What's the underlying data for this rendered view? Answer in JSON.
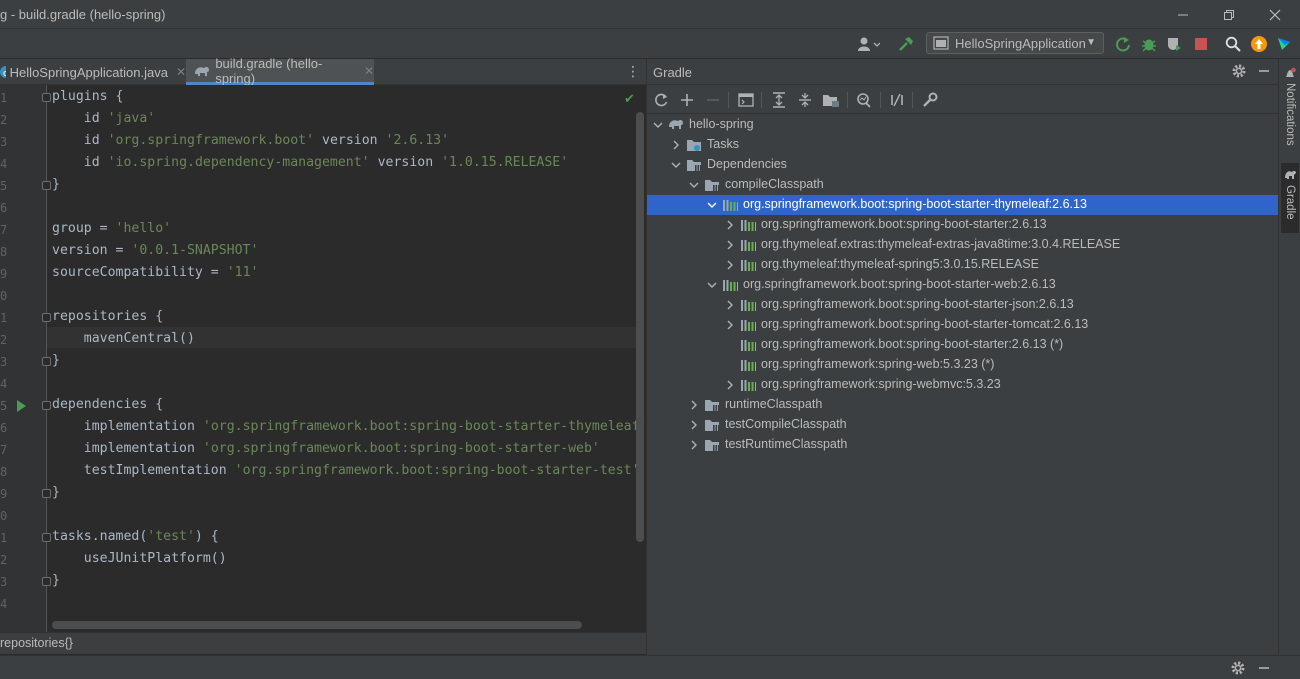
{
  "window": {
    "title": "g - build.gradle (hello-spring)",
    "minimize_glyph": "—",
    "restore_glyph": "❐",
    "close_glyph": "✕"
  },
  "toolbar": {
    "run_config_label": "HelloSpringApplication",
    "icons": [
      "user-icon",
      "hammer-icon",
      "run-config-icon",
      "rerun-icon",
      "debug-icon",
      "coverage-icon",
      "stop-icon",
      "search-icon",
      "update-icon",
      "plugin-icon"
    ]
  },
  "tabs": [
    {
      "label": "HelloSpringApplication.java",
      "active": false
    },
    {
      "label": "build.gradle (hello-spring)",
      "active": true
    }
  ],
  "editor": {
    "line_numbers": [
      "1",
      "2",
      "3",
      "4",
      "5",
      "6",
      "7",
      "8",
      "9",
      "0",
      "1",
      "2",
      "3",
      "4",
      "5",
      "6",
      "7",
      "8",
      "9",
      "0",
      "1",
      "2",
      "3",
      "4"
    ],
    "lines": [
      "plugins {",
      "    id 'java'",
      "    id 'org.springframework.boot' version '2.6.13'",
      "    id 'io.spring.dependency-management' version '1.0.15.RELEASE'",
      "}",
      "",
      "group = 'hello'",
      "version = '0.0.1-SNAPSHOT'",
      "sourceCompatibility = '11'",
      "",
      "repositories {",
      "    mavenCentral()",
      "}",
      "",
      "dependencies {",
      "    implementation 'org.springframework.boot:spring-boot-starter-thymeleaf'",
      "    implementation 'org.springframework.boot:spring-boot-starter-web'",
      "    testImplementation 'org.springframework.boot:spring-boot-starter-test'",
      "}",
      "",
      "tasks.named('test') {",
      "    useJUnitPlatform()",
      "}",
      ""
    ]
  },
  "breadcrumb": "repositories{}",
  "gradle": {
    "title": "Gradle",
    "tree": [
      {
        "depth": 0,
        "label": "hello-spring",
        "icon": "elephant",
        "expanded": true,
        "selected": false
      },
      {
        "depth": 1,
        "label": "Tasks",
        "icon": "folder-gear",
        "expanded": false,
        "selected": false
      },
      {
        "depth": 1,
        "label": "Dependencies",
        "icon": "folder-lib",
        "expanded": true,
        "selected": false
      },
      {
        "depth": 2,
        "label": "compileClasspath",
        "icon": "folder-lib",
        "expanded": true,
        "selected": false
      },
      {
        "depth": 3,
        "label": "org.springframework.boot:spring-boot-starter-thymeleaf:2.6.13",
        "icon": "lib",
        "expanded": true,
        "selected": true
      },
      {
        "depth": 4,
        "label": "org.springframework.boot:spring-boot-starter:2.6.13",
        "icon": "lib",
        "expanded": false,
        "selected": false
      },
      {
        "depth": 4,
        "label": "org.thymeleaf.extras:thymeleaf-extras-java8time:3.0.4.RELEASE",
        "icon": "lib",
        "expanded": false,
        "selected": false
      },
      {
        "depth": 4,
        "label": "org.thymeleaf:thymeleaf-spring5:3.0.15.RELEASE",
        "icon": "lib",
        "expanded": false,
        "selected": false
      },
      {
        "depth": 3,
        "label": "org.springframework.boot:spring-boot-starter-web:2.6.13",
        "icon": "lib",
        "expanded": true,
        "selected": false
      },
      {
        "depth": 4,
        "label": "org.springframework.boot:spring-boot-starter-json:2.6.13",
        "icon": "lib",
        "expanded": false,
        "selected": false
      },
      {
        "depth": 4,
        "label": "org.springframework.boot:spring-boot-starter-tomcat:2.6.13",
        "icon": "lib",
        "expanded": false,
        "selected": false
      },
      {
        "depth": 4,
        "label": "org.springframework.boot:spring-boot-starter:2.6.13 (*)",
        "icon": "lib",
        "expanded": null,
        "selected": false
      },
      {
        "depth": 4,
        "label": "org.springframework:spring-web:5.3.23 (*)",
        "icon": "lib",
        "expanded": null,
        "selected": false
      },
      {
        "depth": 4,
        "label": "org.springframework:spring-webmvc:5.3.23",
        "icon": "lib",
        "expanded": false,
        "selected": false
      },
      {
        "depth": 2,
        "label": "runtimeClasspath",
        "icon": "folder-lib",
        "expanded": false,
        "selected": false
      },
      {
        "depth": 2,
        "label": "testCompileClasspath",
        "icon": "folder-lib",
        "expanded": false,
        "selected": false
      },
      {
        "depth": 2,
        "label": "testRuntimeClasspath",
        "icon": "folder-lib",
        "expanded": false,
        "selected": false
      }
    ]
  },
  "right_sidebar": {
    "notifications_label": "Notifications",
    "gradle_label": "Gradle"
  },
  "colors": {
    "selection": "#2f65ca",
    "keyword": "#cc7832",
    "string": "#6a8759",
    "success": "#499c54",
    "stop": "#c75450"
  }
}
